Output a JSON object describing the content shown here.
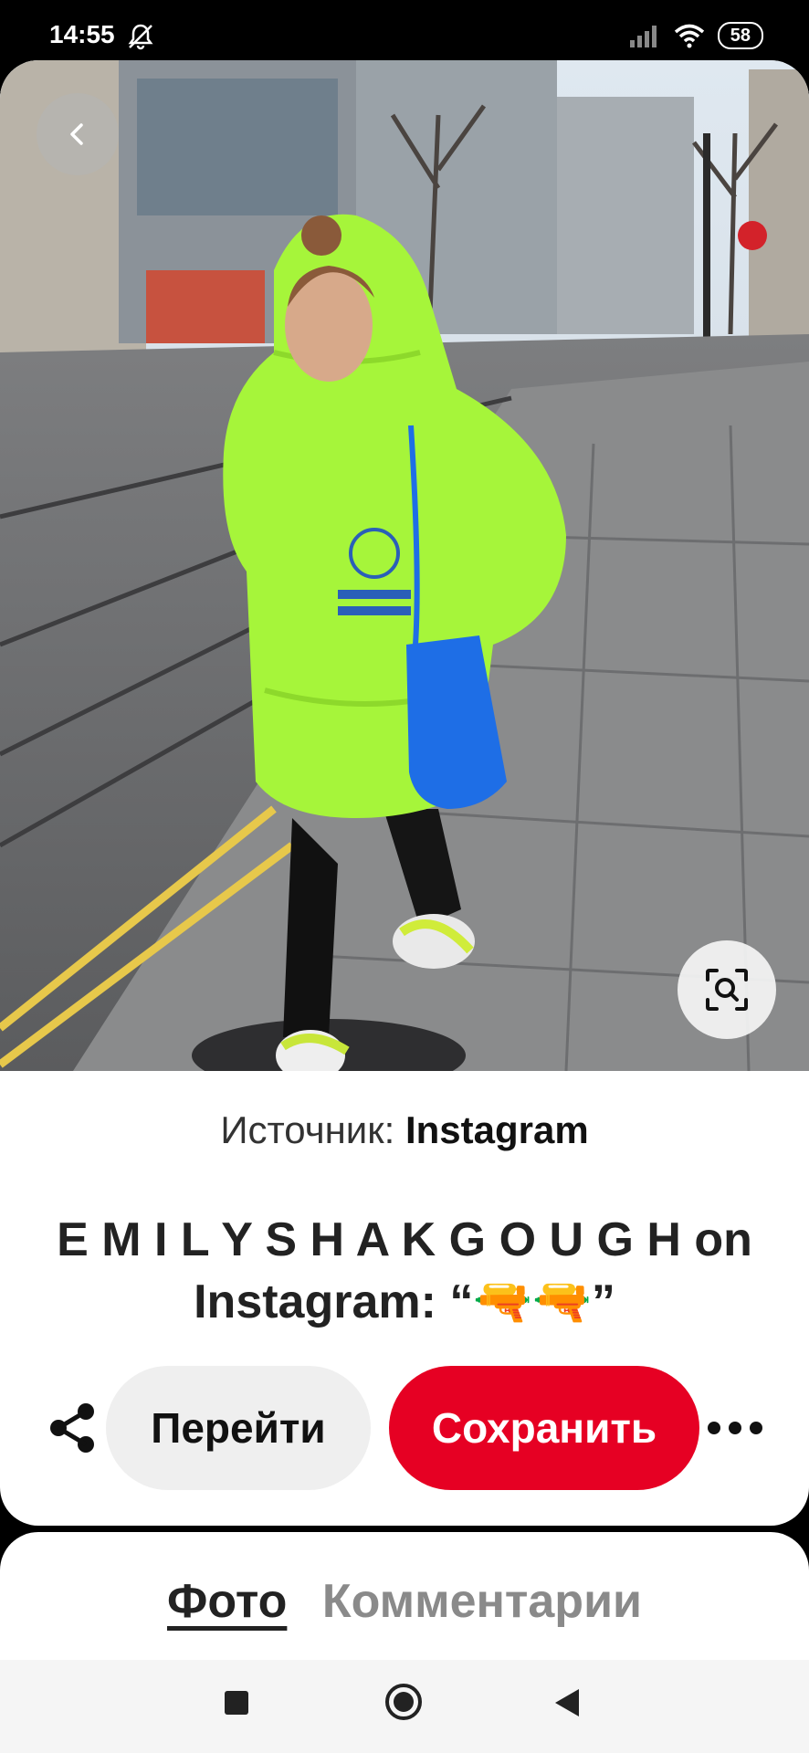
{
  "status_bar": {
    "time": "14:55",
    "battery": "58"
  },
  "pin": {
    "source_label": "Источник:",
    "source_name": "Instagram",
    "title_line1": "E M I L Y S H A K G O U G H on",
    "title_line2": "Instagram: “🔫🔫”"
  },
  "actions": {
    "go_label": "Перейти",
    "save_label": "Сохранить"
  },
  "tabs": {
    "photo": "Фото",
    "comments": "Комментарии"
  },
  "colors": {
    "save_red": "#e60023",
    "hoodie": "#a6f53a",
    "bag": "#1e6ee6"
  }
}
